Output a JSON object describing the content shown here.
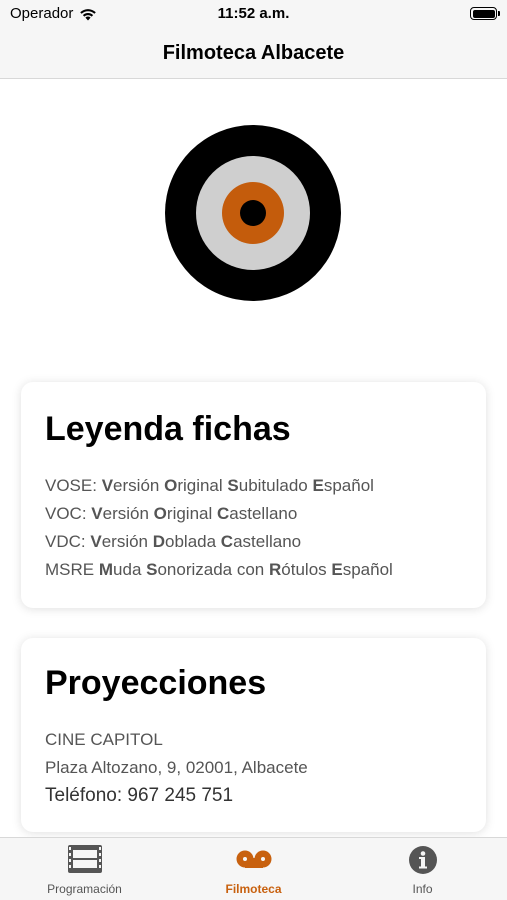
{
  "status": {
    "carrier": "Operador",
    "time": "11:52 a.m."
  },
  "nav": {
    "title": "Filmoteca Albacete"
  },
  "colors": {
    "accent": "#c8610f",
    "tab_inactive": "#555555"
  },
  "legend": {
    "title": "Leyenda fichas",
    "lines": [
      {
        "code": "VOSE:",
        "parts": [
          {
            "b": "V",
            "t": "ersión "
          },
          {
            "b": "O",
            "t": "riginal "
          },
          {
            "b": "S",
            "t": "ubitulado "
          },
          {
            "b": "E",
            "t": "spañol"
          }
        ]
      },
      {
        "code": "VOC:",
        "parts": [
          {
            "b": "V",
            "t": "ersión "
          },
          {
            "b": "O",
            "t": "riginal "
          },
          {
            "b": "C",
            "t": "astellano"
          }
        ]
      },
      {
        "code": "VDC:",
        "parts": [
          {
            "b": "V",
            "t": "ersión "
          },
          {
            "b": "D",
            "t": "oblada "
          },
          {
            "b": "C",
            "t": "astellano"
          }
        ]
      },
      {
        "code": "MSRE",
        "parts": [
          {
            "b": "M",
            "t": "uda "
          },
          {
            "b": "S",
            "t": "onorizada con "
          },
          {
            "b": "R",
            "t": "ótulos "
          },
          {
            "b": "E",
            "t": "spañol"
          }
        ]
      }
    ]
  },
  "projections": {
    "title": "Proyecciones",
    "venue": "CINE CAPITOL",
    "address": "Plaza Altozano, 9, 02001, Albacete",
    "phone": "Teléfono: 967 245 751"
  },
  "tabs": [
    {
      "label": "Programación",
      "icon": "film-icon",
      "active": false
    },
    {
      "label": "Filmoteca",
      "icon": "film-reel-icon",
      "active": true
    },
    {
      "label": "Info",
      "icon": "info-icon",
      "active": false
    }
  ]
}
